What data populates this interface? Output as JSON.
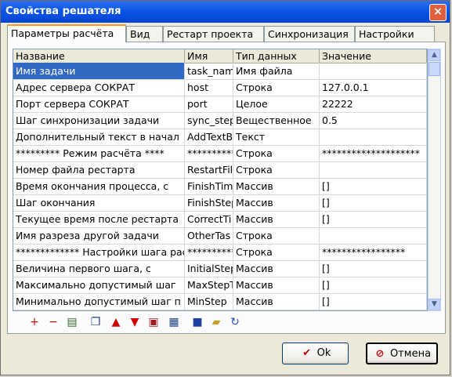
{
  "window": {
    "title": "Свойства решателя",
    "close": "×"
  },
  "tabs": [
    {
      "label": "Параметры расчёта",
      "active": true
    },
    {
      "label": "Вид",
      "active": false
    },
    {
      "label": "Рестарт проекта",
      "active": false
    },
    {
      "label": "Синхронизация",
      "active": false
    },
    {
      "label": "Настройки",
      "active": false
    }
  ],
  "grid": {
    "headers": [
      "Название",
      "Имя",
      "Тип данных",
      "Значение"
    ],
    "rows": [
      [
        "Имя задачи",
        "task_nam",
        "Имя файла",
        ""
      ],
      [
        "Адрес сервера СОКРАТ",
        "host",
        "Строка",
        "127.0.0.1"
      ],
      [
        "Порт сервера СОКРАТ",
        "port",
        "Целое",
        "22222"
      ],
      [
        "Шаг синхронизации задачи",
        "sync_step",
        "Вещественное",
        "0.5"
      ],
      [
        "Дополнительный текст в начал",
        "AddTextB",
        "Текст",
        ""
      ],
      [
        "*********  Режим расчёта  ****",
        "**********",
        "Строка",
        "********************"
      ],
      [
        "Номер файла рестарта",
        "RestartFil",
        "Строка",
        ""
      ],
      [
        "Время окончания процесса, с",
        "FinishTim",
        "Массив",
        "[]"
      ],
      [
        "Шаг окончания",
        "FinishStep",
        "Массив",
        "[]"
      ],
      [
        "Текущее время после рестарта",
        "CorrectTi",
        "Массив",
        "[]"
      ],
      [
        "Имя разреза другой задачи",
        "OtherTas",
        "Строка",
        ""
      ],
      [
        "*************  Настройки шага рас",
        "**********",
        "Строка",
        "*****************"
      ],
      [
        "Величина первого шага, с",
        "InitialStep",
        "Массив",
        "[]"
      ],
      [
        "Максимально допустимый шаг",
        "MaxStepT",
        "Массив",
        "[]"
      ],
      [
        "Минимально допустимый шаг п",
        "MinStep",
        "Массив",
        "[]"
      ]
    ]
  },
  "scroll": {
    "up": "▲",
    "down": "▼"
  },
  "toolbar": [
    {
      "name": "add-row-icon",
      "glyph": "+",
      "color": "#c00000"
    },
    {
      "name": "remove-row-icon",
      "glyph": "−",
      "color": "#c00000"
    },
    {
      "name": "properties-icon",
      "glyph": "▤",
      "color": "#2a6a2a"
    },
    {
      "name": "copy-icon",
      "glyph": "❐",
      "color": "#204080"
    },
    {
      "name": "move-up-icon",
      "glyph": "▲",
      "color": "#d00000"
    },
    {
      "name": "move-down-icon",
      "glyph": "▼",
      "color": "#d00000"
    },
    {
      "name": "paste-icon",
      "glyph": "▣",
      "color": "#a02020"
    },
    {
      "name": "clone-icon",
      "glyph": "▦",
      "color": "#204080"
    },
    {
      "name": "save-icon",
      "glyph": "■",
      "color": "#2040a0"
    },
    {
      "name": "open-icon",
      "glyph": "▰",
      "color": "#c8a020"
    },
    {
      "name": "refresh-icon",
      "glyph": "↻",
      "color": "#2050c0"
    }
  ],
  "buttons": {
    "ok": {
      "label": "Ok",
      "icon": "✔",
      "color": "#c00000"
    },
    "cancel": {
      "label": "Отмена",
      "icon": "⊘",
      "color": "#d00000"
    }
  }
}
